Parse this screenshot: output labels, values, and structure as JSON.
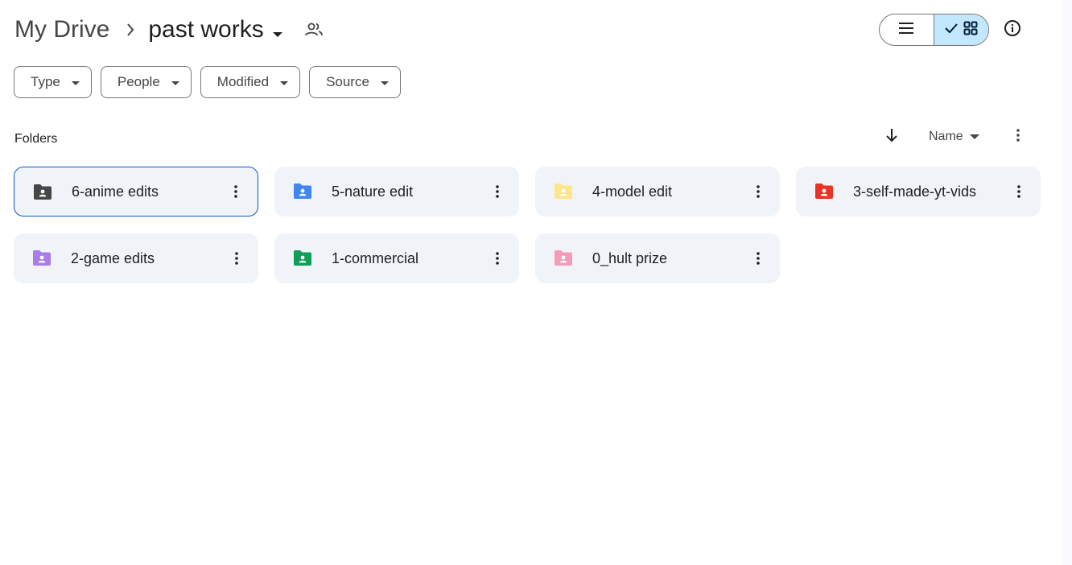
{
  "breadcrumb": {
    "root": "My Drive",
    "current": "past works"
  },
  "filters": [
    {
      "label": "Type"
    },
    {
      "label": "People"
    },
    {
      "label": "Modified"
    },
    {
      "label": "Source"
    }
  ],
  "section": {
    "label": "Folders",
    "sort_label": "Name"
  },
  "view": {
    "mode": "grid"
  },
  "folders": [
    {
      "name": "6-anime edits",
      "color": "#444746",
      "selected": true
    },
    {
      "name": "5-nature edit",
      "color": "#4285f4",
      "selected": false
    },
    {
      "name": "4-model edit",
      "color": "#fde68a",
      "selected": false
    },
    {
      "name": "3-self-made-yt-vids",
      "color": "#ea3323",
      "selected": false
    },
    {
      "name": "2-game edits",
      "color": "#a97ce8",
      "selected": false
    },
    {
      "name": "1-commercial",
      "color": "#0f9d58",
      "selected": false
    },
    {
      "name": "0_hult prize",
      "color": "#f59bb8",
      "selected": false
    }
  ],
  "icons": {
    "breadcrumb_separator": "chevron-right-icon",
    "shared": "people-icon",
    "list_view": "list-icon",
    "grid_view": "grid-icon",
    "info": "info-icon",
    "sort_direction": "arrow-down-icon",
    "more": "more-vert-icon"
  }
}
